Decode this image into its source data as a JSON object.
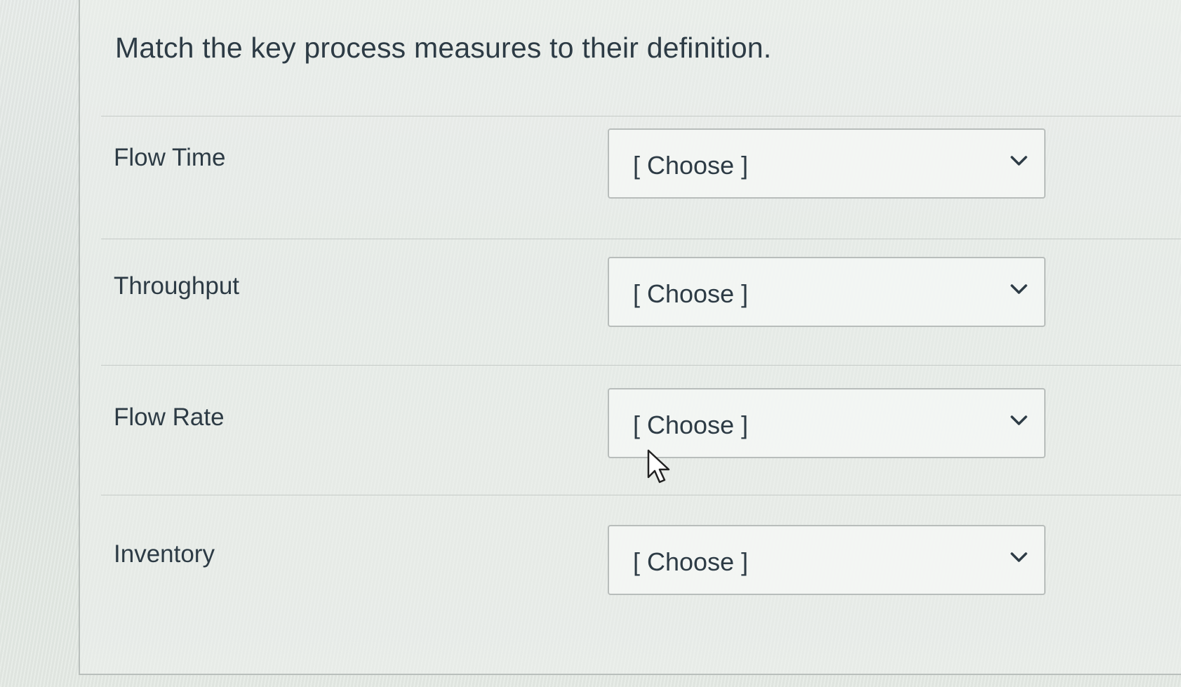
{
  "question": {
    "title": "Match the key process measures to their definition."
  },
  "rows": [
    {
      "term": "Flow Time",
      "selected": "[ Choose ]"
    },
    {
      "term": "Throughput",
      "selected": "[ Choose ]"
    },
    {
      "term": "Flow Rate",
      "selected": "[ Choose ]"
    },
    {
      "term": "Inventory",
      "selected": "[ Choose ]"
    }
  ],
  "icons": {
    "dropdown": "chevron-down-icon",
    "pointer": "mouse-pointer-icon"
  },
  "colors": {
    "text": "#2d3b45",
    "border": "#b8bdbb"
  }
}
